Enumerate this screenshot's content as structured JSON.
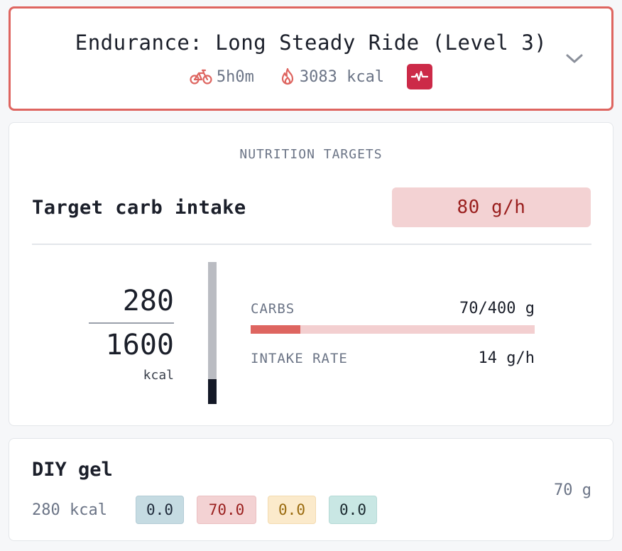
{
  "workout": {
    "title": "Endurance: Long Steady Ride (Level 3)",
    "duration": "5h0m",
    "calories": "3083 kcal",
    "icons": [
      "bike-icon",
      "flame-icon",
      "pulse-icon",
      "chevron-down-icon"
    ],
    "accent_color": "#de6560",
    "badge_color": "#cc2a48"
  },
  "nutrition": {
    "section_title": "NUTRITION TARGETS",
    "target_label": "Target carb intake",
    "target_value": "80 g/h",
    "kcal_consumed": "280",
    "kcal_total": "1600",
    "kcal_unit": "kcal",
    "kcal_progress_fraction": 0.175,
    "carbs_label": "CARBS",
    "carbs_value": "70/400 g",
    "carbs_progress_fraction": 0.175,
    "rate_label": "INTAKE RATE",
    "rate_value": "14 g/h"
  },
  "food": {
    "name": "DIY gel",
    "kcal": "280 kcal",
    "macros": [
      "0.0",
      "70.0",
      "0.0",
      "0.0"
    ],
    "weight": "70 g"
  }
}
